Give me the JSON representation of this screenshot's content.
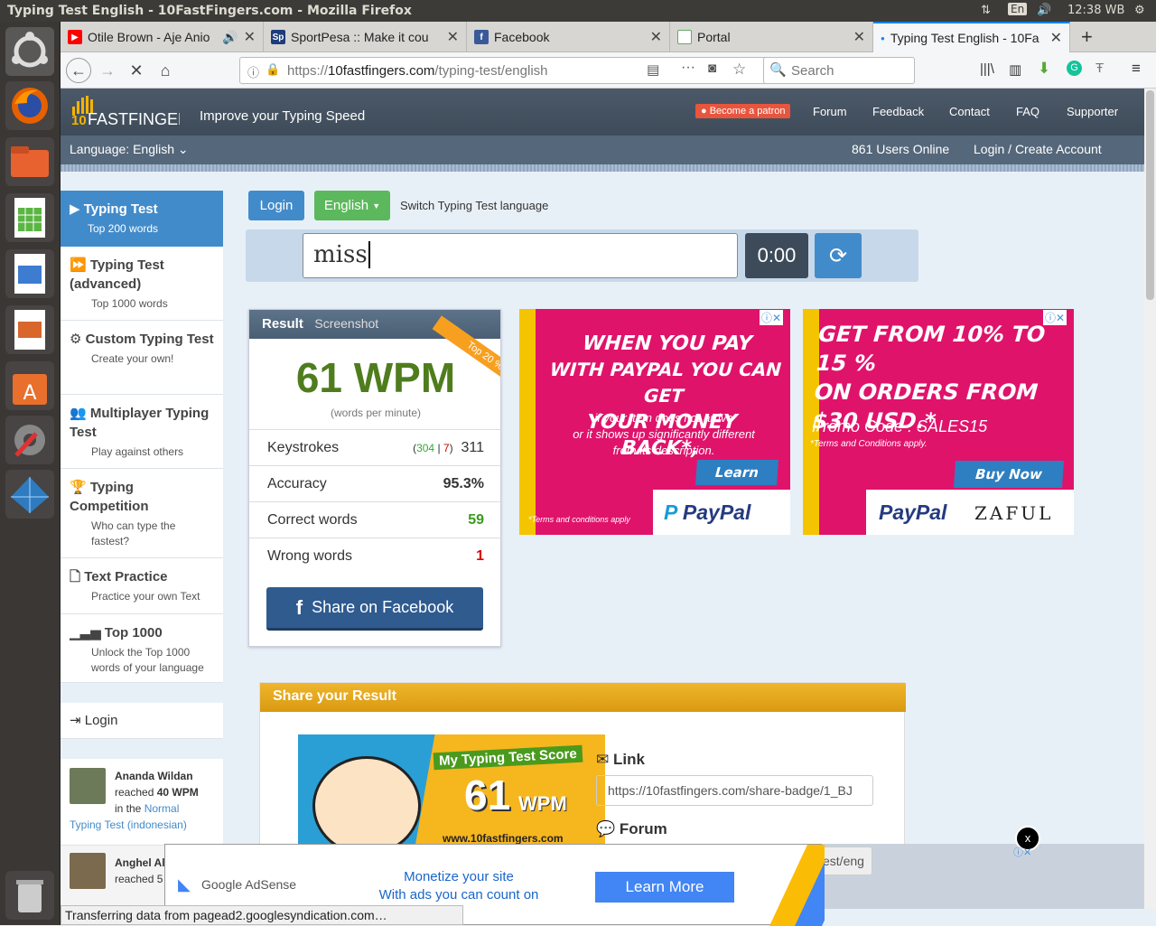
{
  "os": {
    "window_title": "Typing Test English - 10FastFingers.com - Mozilla Firefox",
    "keyboard": "En",
    "time": "12:38 WB"
  },
  "tabs": [
    {
      "label": "Otile Brown - Aje Anio",
      "favicon": "youtube-icon"
    },
    {
      "label": "SportPesa :: Make it cou",
      "favicon": "sportpesa-icon"
    },
    {
      "label": "Facebook",
      "favicon": "facebook-icon"
    },
    {
      "label": "Portal",
      "favicon": "portal-icon"
    },
    {
      "label": "Typing Test English - 10Fa",
      "favicon": "loading-icon",
      "active": true
    }
  ],
  "nav": {
    "url_prefix": "https://",
    "url_domain": "10fastfingers.com",
    "url_path": "/typing-test/english",
    "search_placeholder": "Search"
  },
  "site": {
    "logo_text": "FASTFINGERS",
    "logo_10": "10",
    "tagline": "Improve your Typing Speed",
    "patron": "Become a patron",
    "menu": [
      "Forum",
      "Feedback",
      "Contact",
      "FAQ",
      "Supporter"
    ],
    "language_label": "Language: English",
    "users_online": "861 Users Online",
    "login": "Login",
    "slash": "/",
    "create": "Create Account"
  },
  "sidebar": [
    {
      "title": "Typing Test",
      "sub": "Top 200 words",
      "icon": "play-icon"
    },
    {
      "title": "Typing Test (advanced)",
      "sub": "Top 1000 words",
      "icon": "fast-forward-icon"
    },
    {
      "title": "Custom Typing Test",
      "sub": "Create your own!",
      "icon": "cogs-icon"
    },
    {
      "title": "Multiplayer Typing Test",
      "sub": "Play against others",
      "icon": "users-icon"
    },
    {
      "title": "Typing Competition",
      "sub": "Who can type the fastest?",
      "icon": "trophy-icon"
    },
    {
      "title": "Text Practice",
      "sub": "Practice your own Text",
      "icon": "file-icon"
    },
    {
      "title": "Top 1000",
      "sub": "Unlock the Top 1000 words of your language",
      "icon": "signal-icon"
    }
  ],
  "sidebar_login": "Login",
  "activity": [
    {
      "name": "Ananda Wildan",
      "reached": "reached",
      "wpm": "40 WPM",
      "in_the": "in the",
      "mode": "Normal",
      "test": "Typing Test (indonesian)"
    },
    {
      "name": "Anghel Alexandr",
      "reached": "reached 5"
    }
  ],
  "test": {
    "login_btn": "Login",
    "lang_btn": "English",
    "switch_label": "Switch Typing Test language",
    "input_value": "miss",
    "timer": "0:00"
  },
  "result": {
    "tab_result": "Result",
    "tab_screenshot": "Screenshot",
    "ribbon": "Top 20 %",
    "wpm": "61 WPM",
    "wpm_sub": "(words per minute)",
    "rows": [
      {
        "label": "Keystrokes",
        "correct": "304",
        "sep": "|",
        "wrong": "7",
        "value": "311"
      },
      {
        "label": "Accuracy",
        "value": "95.3%"
      },
      {
        "label": "Correct words",
        "value": "59"
      },
      {
        "label": "Wrong words",
        "value": "1"
      }
    ],
    "share_fb": "Share on Facebook"
  },
  "ads": {
    "left": {
      "l1": "WHEN YOU PAY",
      "l2": "WITH PAYPAL YOU CAN GET",
      "l3": "YOUR MONEY BACK*,",
      "s1": "if your item does not arrive",
      "s2": "or it shows up significantly different",
      "s3": "from its description.",
      "cta": "Learn more",
      "terms": "*Terms and conditions apply",
      "brand": "PayPal"
    },
    "right": {
      "l1": "GET FROM 10% TO 15 %",
      "l2": "ON ORDERS FROM",
      "l3": "$30 USD.*",
      "promo": "Promo Code : SALES15",
      "terms": "*Terms and Conditions apply.",
      "cta": "Buy Now",
      "brand1": "PayPal",
      "brand2": "ZAFUL"
    }
  },
  "share": {
    "header": "Share your Result",
    "badge_title": "My Typing Test Score",
    "badge_wpm": "61",
    "badge_unit": "WPM",
    "badge_site": "www.10fastfingers.com",
    "link_label": "Link",
    "link_value": "https://10fastfingers.com/share-badge/1_BJ",
    "forum_label": "Forum",
    "forum_partial": "est/eng"
  },
  "bottom_ad": {
    "brand": "Google AdSense",
    "line1": "Monetize your site",
    "line2": "With ads you can count on",
    "cta": "Learn More",
    "close": "x"
  },
  "status": "Transferring data from pagead2.googlesyndication.com…"
}
